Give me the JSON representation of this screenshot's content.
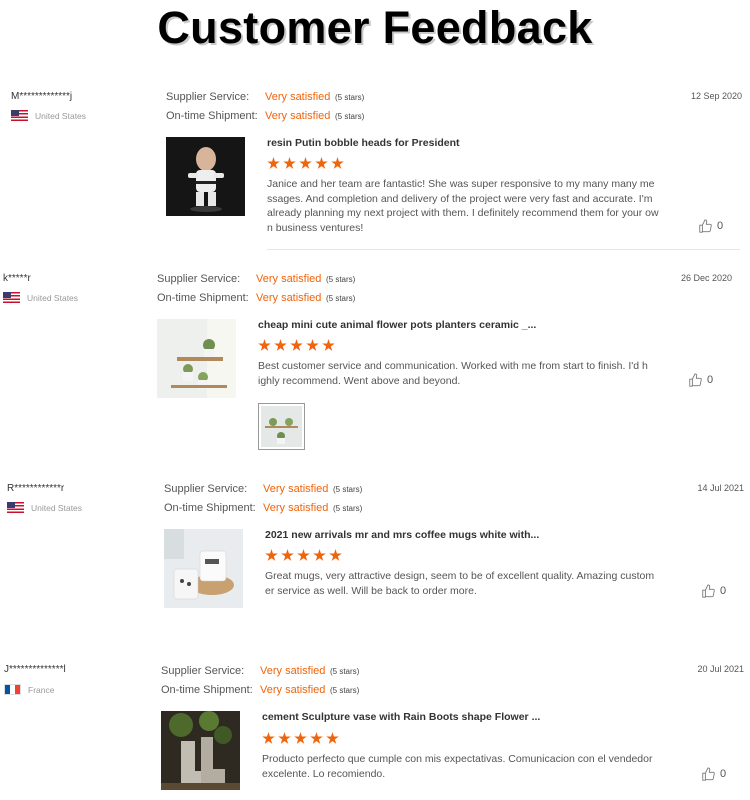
{
  "page_title": "Customer Feedback",
  "labels": {
    "supplier_service": "Supplier Service:",
    "shipment": "On-time Shipment:"
  },
  "colors": {
    "accent": "#f0640b",
    "star": "#f0640b"
  },
  "reviews": [
    {
      "buyer": "M*************j",
      "country": "United States",
      "flag": "us",
      "supplier_value": "Very satisfied",
      "supplier_stars": "(5 stars)",
      "shipment_value": "Very satisfied",
      "shipment_stars": "(5 stars)",
      "date": "12 Sep 2020",
      "product_title": "resin Putin bobble heads for President",
      "rating": 5,
      "comment": "Janice and her team are fantastic! She was super responsive to my many many messages. And completion and delivery of the project were very fast and accurate. I'm already planning my next project with them. I definitely recommend them for your own business ventures!",
      "likes": "0",
      "image_icon": "bobblehead-photo"
    },
    {
      "buyer": "k*****r",
      "country": "United States",
      "flag": "us",
      "supplier_value": "Very satisfied",
      "supplier_stars": "(5 stars)",
      "shipment_value": "Very satisfied",
      "shipment_stars": "(5 stars)",
      "date": "26 Dec 2020",
      "product_title": "cheap mini cute animal flower pots planters ceramic _...",
      "rating": 5,
      "comment": "Best customer service and communication. Worked with me from start to finish. I'd highly recommend.  Went above and beyond.",
      "likes": "0",
      "image_icon": "planters-photo"
    },
    {
      "buyer": "R************r",
      "country": "United States",
      "flag": "us",
      "supplier_value": "Very satisfied",
      "supplier_stars": "(5 stars)",
      "shipment_value": "Very satisfied",
      "shipment_stars": "(5 stars)",
      "date": "14 Jul 2021",
      "product_title": "2021 new arrivals mr and mrs coffee mugs white with...",
      "rating": 5,
      "comment": "Great mugs, very attractive design, seem to be of excellent quality. Amazing customer service as well. Will be back to order more.",
      "likes": "0",
      "image_icon": "mugs-photo"
    },
    {
      "buyer": "J**************l",
      "country": "France",
      "flag": "fr",
      "supplier_value": "Very satisfied",
      "supplier_stars": "(5 stars)",
      "shipment_value": "Very satisfied",
      "shipment_stars": "(5 stars)",
      "date": "20 Jul 2021",
      "product_title": "cement Sculpture vase with Rain Boots shape Flower ...",
      "rating": 5,
      "comment": "Producto perfecto que cumple con mis expectativas. Comunicacion con el vendedor excelente. Lo recomiendo.",
      "likes": "0",
      "image_icon": "boots-vase-photo"
    }
  ]
}
